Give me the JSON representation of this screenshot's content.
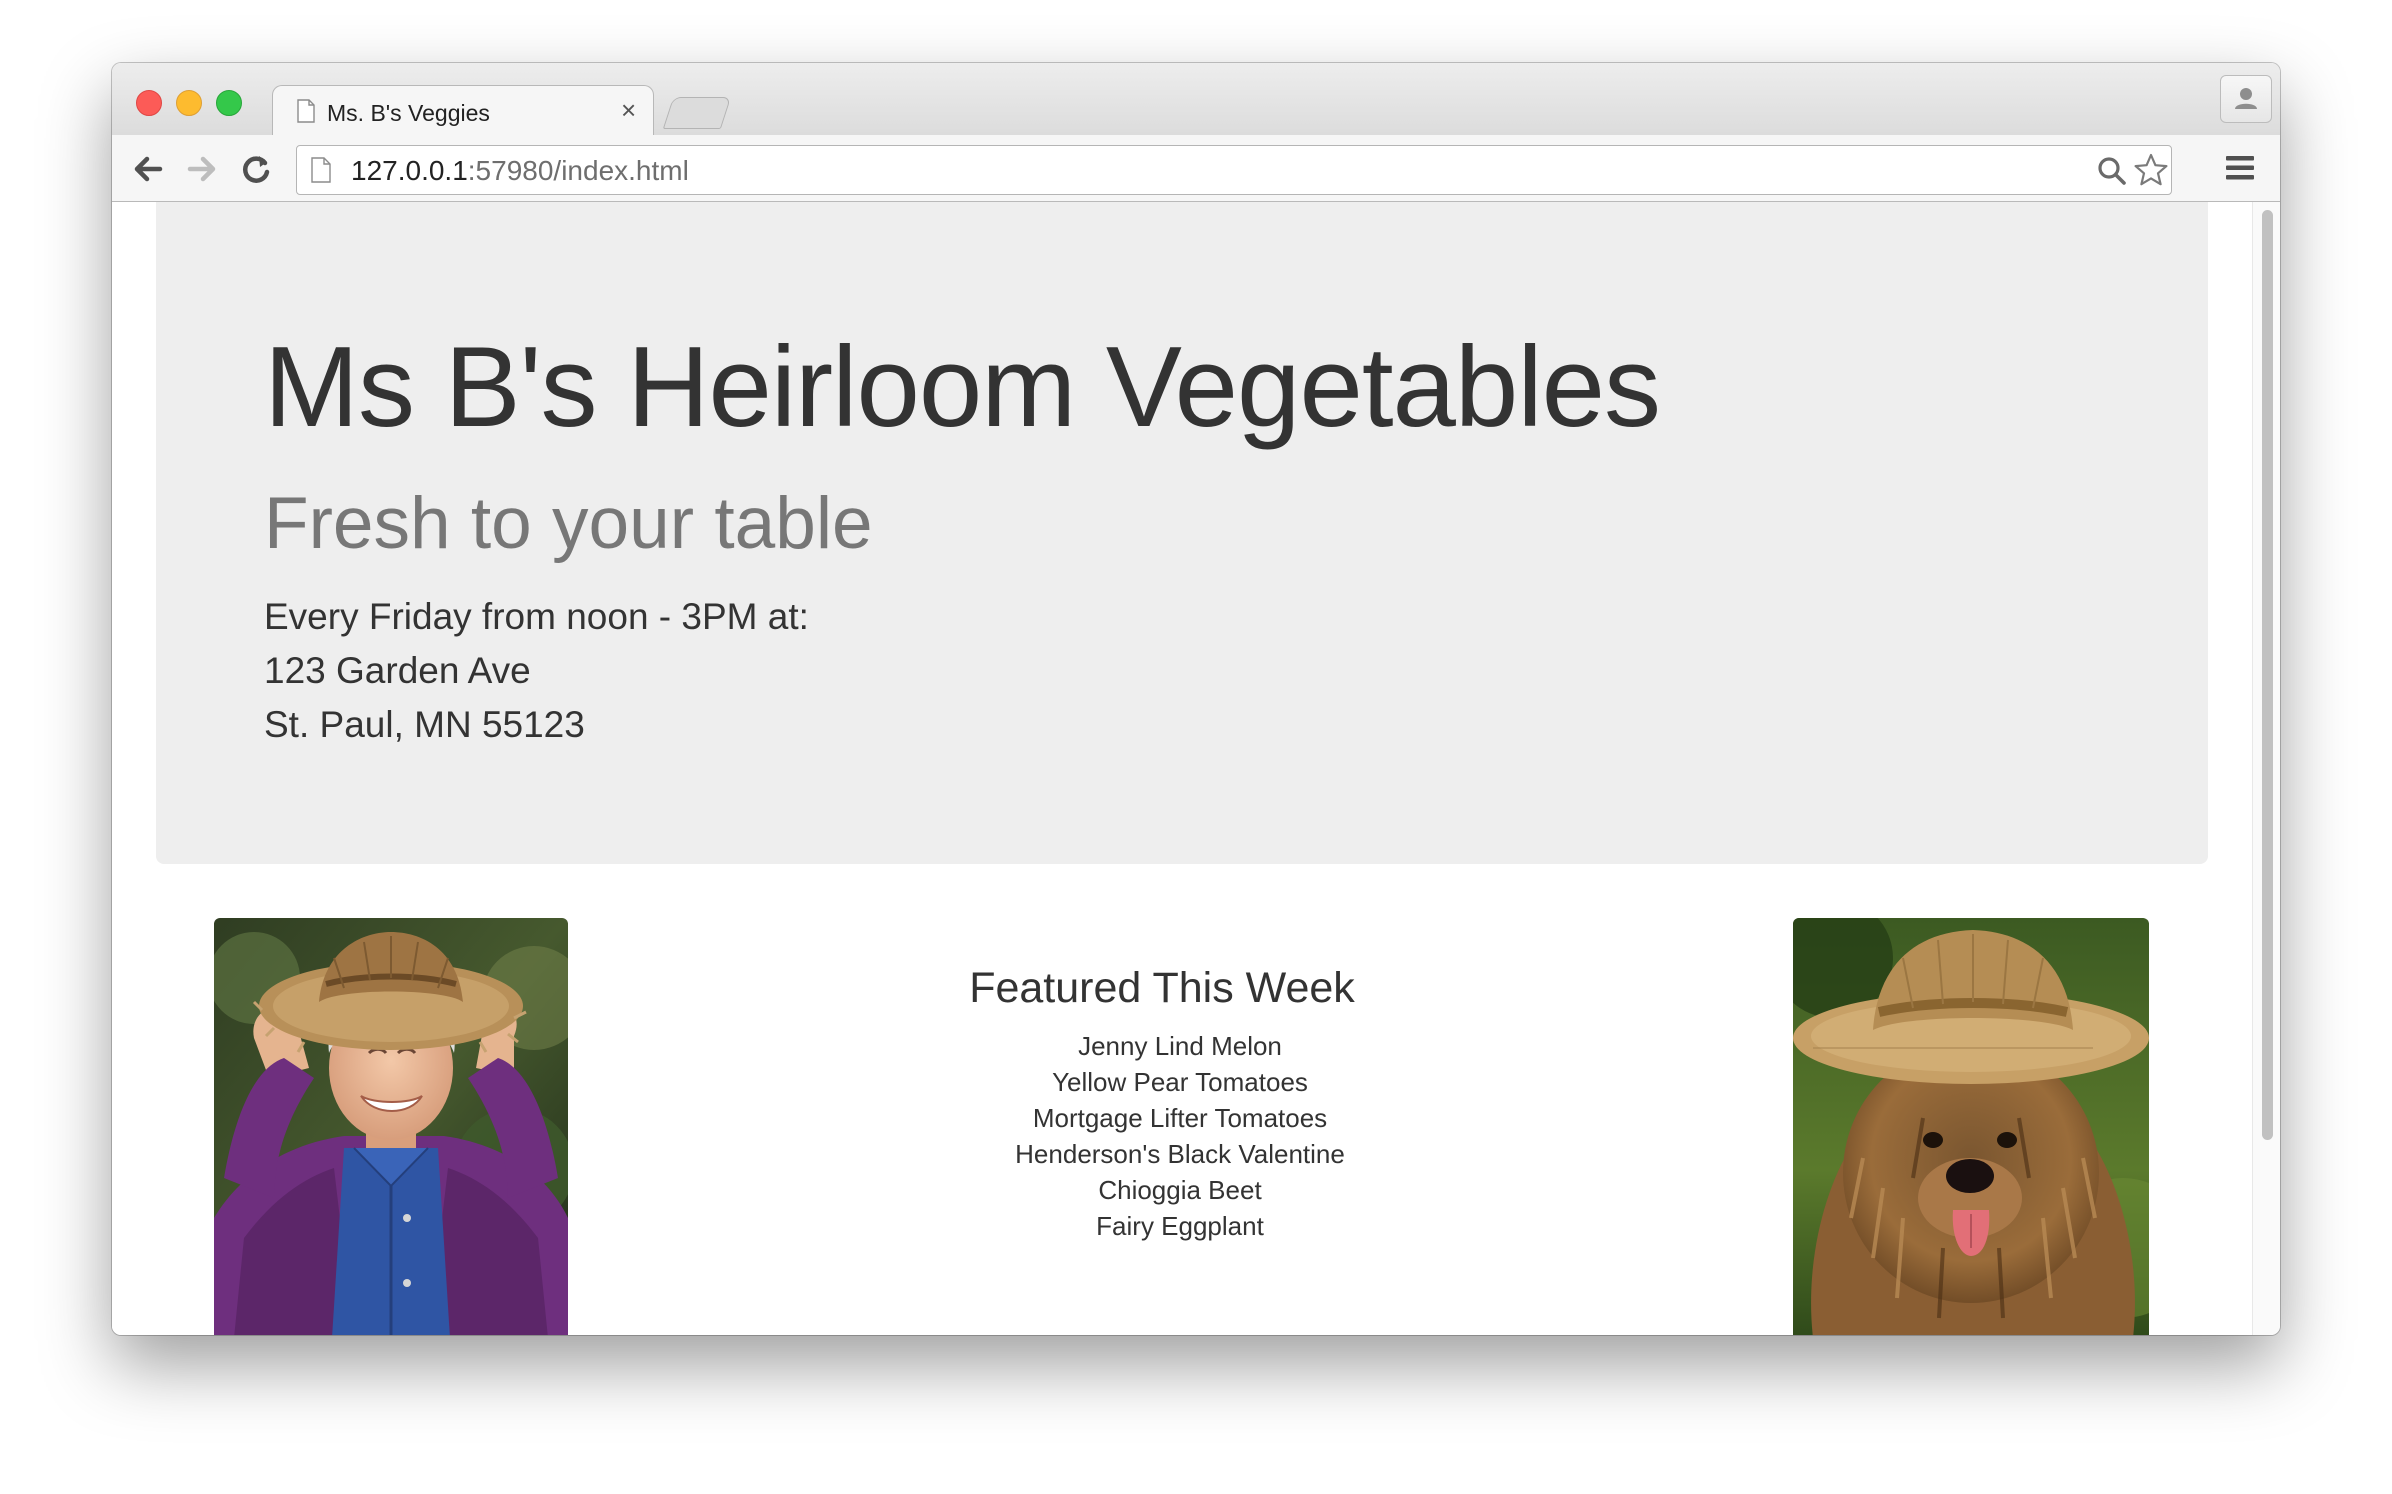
{
  "browser": {
    "tab": {
      "title": "Ms. B's Veggies",
      "close_glyph": "×"
    },
    "omnibox": {
      "url_host": "127.0.0.1",
      "url_rest": ":57980/index.html"
    },
    "icons": [
      "page-icon",
      "close-icon",
      "back-arrow-icon",
      "forward-arrow-icon",
      "reload-icon",
      "search-icon",
      "bookmark-star-icon",
      "menu-icon",
      "profile-icon"
    ]
  },
  "page": {
    "hero": {
      "title": "Ms B's Heirloom Vegetables",
      "tagline": "Fresh to your table",
      "schedule_lines": [
        "Every Friday from noon - 3PM at:",
        "123 Garden Ave",
        "St. Paul, MN 55123"
      ]
    },
    "featured": {
      "heading": "Featured This Week",
      "items": [
        "Jenny Lind Melon",
        "Yellow Pear Tomatoes",
        "Mortgage Lifter Tomatoes",
        "Henderson's Black Valentine",
        "Chioggia Beet",
        "Fairy Eggplant"
      ]
    },
    "photos": {
      "left": "woman-in-straw-hat-photo",
      "right": "dog-in-straw-hat-photo"
    }
  },
  "colors": {
    "jumbotron_bg": "#eeeeee",
    "title_text": "#333333",
    "tagline_text": "#777777",
    "traffic_red": "#fc5b57",
    "traffic_yellow": "#fdbb2f",
    "traffic_green": "#34c84a"
  }
}
